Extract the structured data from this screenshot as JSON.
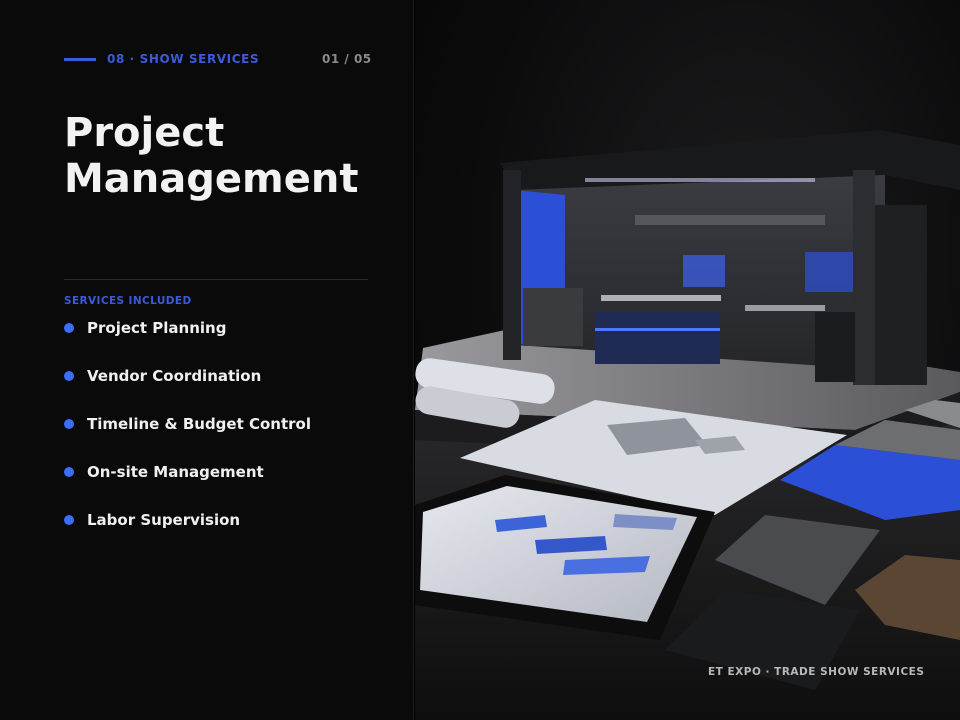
{
  "header": {
    "eyebrow": "08 · SHOW SERVICES",
    "counter": "01 / 05"
  },
  "title": {
    "line1": "Project",
    "line2": "Management"
  },
  "services": {
    "label": "SERVICES INCLUDED",
    "items": [
      "Project Planning",
      "Vendor Coordination",
      "Timeline & Budget Control",
      "On-site Management",
      "Labor Supervision"
    ]
  },
  "footer": "ET EXPO · TRADE SHOW SERVICES",
  "colors": {
    "accent": "#3b5bdb",
    "bullet": "#3b6ef5",
    "background": "#0a0a0a",
    "text": "#f2f2f2"
  }
}
